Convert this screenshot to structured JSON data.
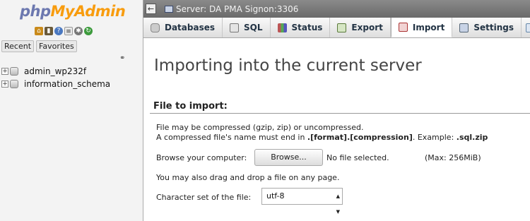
{
  "nav": {
    "logo_php": "php",
    "logo_myadmin": "MyAdmin",
    "quick_icons": [
      "home-icon",
      "logout-icon",
      "help-icon",
      "docs-icon",
      "settings-icon",
      "reload-icon"
    ],
    "recent_label": "Recent",
    "favorites_label": "Favorites",
    "databases": [
      {
        "name": "admin_wp232f"
      },
      {
        "name": "information_schema"
      }
    ]
  },
  "topbar": {
    "collapse_glyph": "←",
    "server_label": "Server: DA PMA Signon:3306"
  },
  "tabs": [
    {
      "label": "Databases",
      "icon": "database-icon"
    },
    {
      "label": "SQL",
      "icon": "sql-icon"
    },
    {
      "label": "Status",
      "icon": "status-icon"
    },
    {
      "label": "Export",
      "icon": "export-icon"
    },
    {
      "label": "Import",
      "icon": "import-icon",
      "active": true
    },
    {
      "label": "Settings",
      "icon": "wrench-icon"
    }
  ],
  "main": {
    "title": "Importing into the current server",
    "section_title": "File to import:",
    "compress_note": "File may be compressed (gzip, zip) or uncompressed.",
    "name_note_prefix": "A compressed file's name must end in ",
    "name_note_format": ".[format].[compression]",
    "name_note_example": ". Example: ",
    "name_note_ext": ".sql.zip",
    "browse_label": "Browse your computer:",
    "browse_button": "Browse...",
    "no_file": "No file selected.",
    "max_size": "(Max: 256MiB)",
    "drag_note": "You may also drag and drop a file on any page.",
    "charset_label": "Character set of the file:",
    "charset_value": "utf-8"
  },
  "colors": {
    "logo_php": "#6c78af",
    "logo_myadmin": "#f89c0e",
    "topbar": "#7a7a7a"
  }
}
